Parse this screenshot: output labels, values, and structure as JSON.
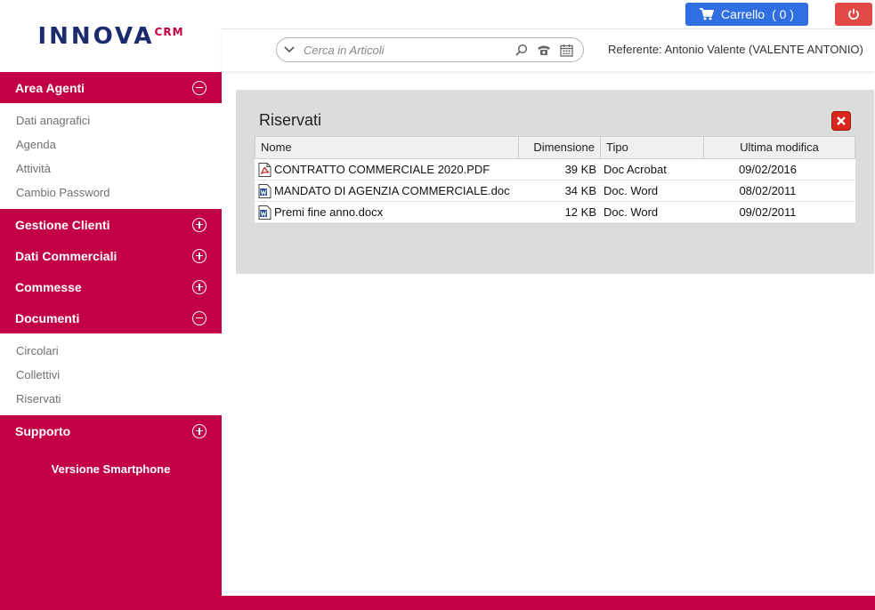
{
  "logo": {
    "main": "INNOVA",
    "sup": "CRM"
  },
  "sidebar": {
    "sections": [
      {
        "label": "Area Agenti",
        "expanded": true,
        "items": [
          "Dati anagrafici",
          "Agenda",
          "Attività",
          "Cambio Password"
        ]
      },
      {
        "label": "Gestione Clienti",
        "expanded": false
      },
      {
        "label": "Dati Commerciali",
        "expanded": false
      },
      {
        "label": "Commesse",
        "expanded": false
      },
      {
        "label": "Documenti",
        "expanded": true,
        "items": [
          "Circolari",
          "Collettivi",
          "Riservati"
        ]
      },
      {
        "label": "Supporto",
        "expanded": false
      }
    ],
    "version_link": "Versione Smartphone"
  },
  "header": {
    "cart_label": "Carrello",
    "cart_count": "( 0 )",
    "search_placeholder": "Cerca in Articoli",
    "referente_label": "Referente:",
    "referente_value": "Antonio Valente (VALENTE ANTONIO)"
  },
  "panel": {
    "title": "Riservati",
    "columns": [
      "Nome",
      "Dimensione",
      "Tipo",
      "Ultima modifica"
    ],
    "rows": [
      {
        "icon": "pdf-icon",
        "name": "CONTRATTO COMMERCIALE 2020.PDF",
        "size": "39 KB",
        "type": "Doc Acrobat",
        "date": "09/02/2016"
      },
      {
        "icon": "word-icon",
        "name": "MANDATO DI AGENZIA COMMERCIALE.doc",
        "size": "34 KB",
        "type": "Doc. Word",
        "date": "08/02/2011"
      },
      {
        "icon": "word-icon",
        "name": "Premi fine anno.docx",
        "size": "12 KB",
        "type": "Doc. Word",
        "date": "09/02/2011"
      }
    ]
  },
  "colors": {
    "brand": "#c30045",
    "cart": "#2f6fe2",
    "power": "#e04a46",
    "logo": "#1c2a6e"
  }
}
